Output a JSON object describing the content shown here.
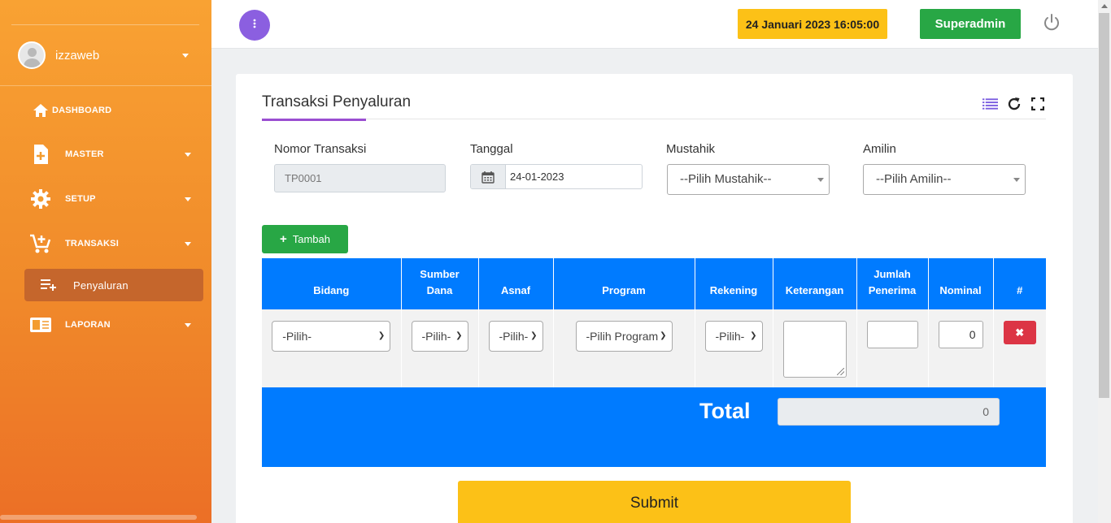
{
  "sidebar": {
    "user_name": "izzaweb",
    "items": [
      {
        "label": "DASHBOARD",
        "icon": "home-icon"
      },
      {
        "label": "MASTER",
        "icon": "file-plus-icon"
      },
      {
        "label": "SETUP",
        "icon": "gear-icon"
      },
      {
        "label": "TRANSAKSI",
        "icon": "cart-plus-icon"
      },
      {
        "label": "LAPORAN",
        "icon": "book-icon"
      }
    ],
    "sub_item": {
      "label": "Penyaluran",
      "icon": "playlist-add-icon"
    }
  },
  "topbar": {
    "datetime": "24 Januari 2023 16:05:00",
    "role": "Superadmin"
  },
  "card": {
    "title": "Transaksi Penyaluran"
  },
  "form": {
    "nomor_label": "Nomor Transaksi",
    "nomor_value": "TP0001",
    "tanggal_label": "Tanggal",
    "tanggal_value": "24-01-2023",
    "mustahik_label": "Mustahik",
    "mustahik_value": "--Pilih Mustahik--",
    "amilin_label": "Amilin",
    "amilin_value": "--Pilih Amilin--"
  },
  "add_button": "Tambah",
  "table": {
    "headers": [
      "Bidang",
      "Sumber Dana",
      "Asnaf",
      "Program",
      "Rekening",
      "Keterangan",
      "Jumlah Penerima",
      "Nominal",
      "#"
    ],
    "row": {
      "bidang": "-Pilih-",
      "sumber_dana": "-Pilih-",
      "asnaf": "-Pilih-",
      "program": "-Pilih Program-",
      "rekening": "-Pilih-",
      "nominal": "0",
      "delete": "✖"
    }
  },
  "total": {
    "label": "Total",
    "value": "0"
  },
  "submit": "Submit",
  "colors": {
    "sidebar": "#f39c2f",
    "primary": "#007bff",
    "success": "#28a745",
    "warning": "#fcc117",
    "danger": "#dc3545",
    "purple": "#8b5fe0"
  }
}
